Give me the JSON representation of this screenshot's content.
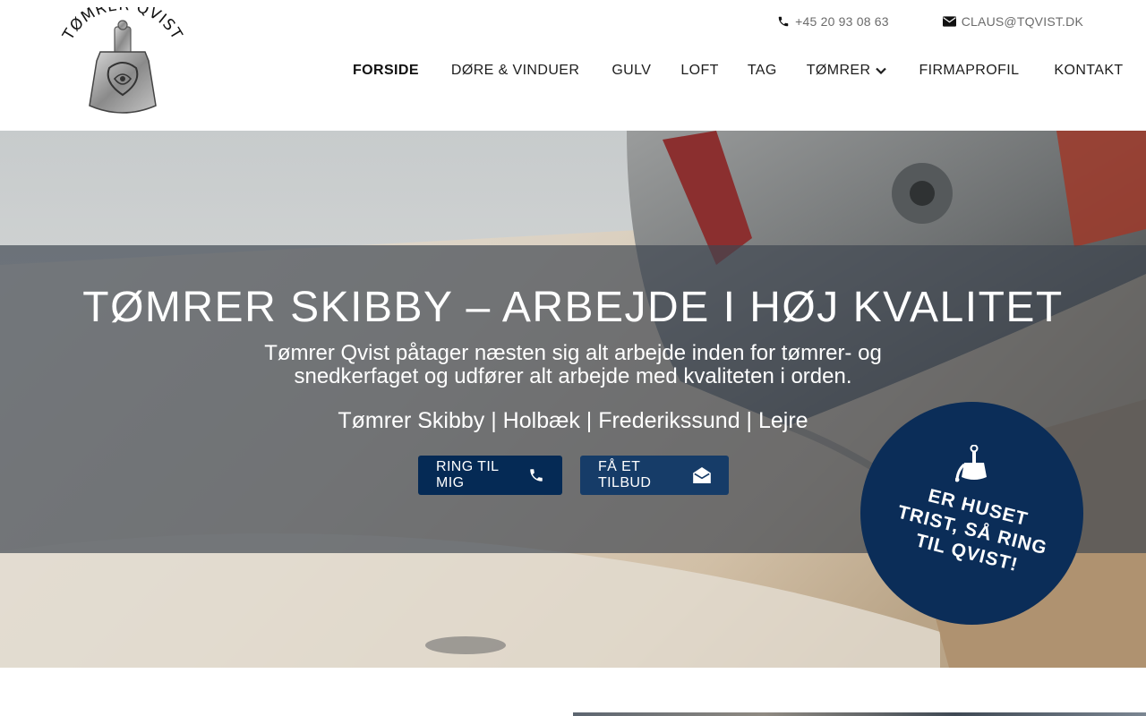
{
  "logo": {
    "text": "TØMRER QVIST",
    "icon": "thors-hammer-icon"
  },
  "contact": {
    "phone": "+45 20 93 08 63",
    "email": "CLAUS@TQVIST.DK"
  },
  "nav": {
    "items": [
      {
        "label": "FORSIDE",
        "active": true
      },
      {
        "label": "DØRE & VINDUER"
      },
      {
        "label": "GULV"
      },
      {
        "label": "LOFT"
      },
      {
        "label": "TAG"
      },
      {
        "label": "TØMRER",
        "dropdown": true
      },
      {
        "label": "FIRMAPROFIL"
      },
      {
        "label": "KONTAKT"
      }
    ]
  },
  "hero": {
    "title": "TØMRER SKIBBY – ARBEJDE I HØJ KVALITET",
    "subtitle": "Tømrer Qvist påtager næsten sig alt arbejde inden for tømrer- og snedkerfaget og udfører alt arbejde med kvaliteten i orden.",
    "towns": "Tømrer Skibby | Holbæk | Frederikssund | Lejre",
    "buttons": {
      "call": "RING TIL MIG",
      "offer": "FÅ ET TILBUD"
    }
  },
  "badge": {
    "text": "ER HUSET\nTRIST, SÅ RING\nTIL QVIST!",
    "icon": "paint-bucket-icon"
  },
  "colors": {
    "navy": "#052a55",
    "badge": "#0b2d58",
    "overlay": "#3e4650"
  }
}
